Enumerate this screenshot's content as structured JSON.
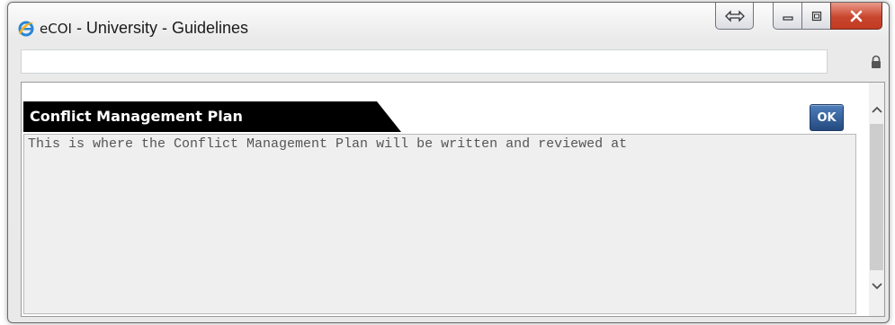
{
  "window": {
    "app_name": "eCOI",
    "title_rest": " - University - Guidelines",
    "icons": {
      "browser": "internet-explorer-icon",
      "compat": "compatibility-view-icon",
      "minimize": "minimize-icon",
      "maximize": "maximize-icon",
      "close": "close-icon",
      "lock": "lock-icon"
    }
  },
  "address_bar": {
    "value": ""
  },
  "content": {
    "section_title": "Conflict Management Plan",
    "ok_label": "OK",
    "plan_text": "This is where the Conflict Management Plan will be written and reviewed at"
  },
  "colors": {
    "header_bg": "#000000",
    "ok_button": "#2f5c96",
    "close_button": "#c9462e"
  }
}
